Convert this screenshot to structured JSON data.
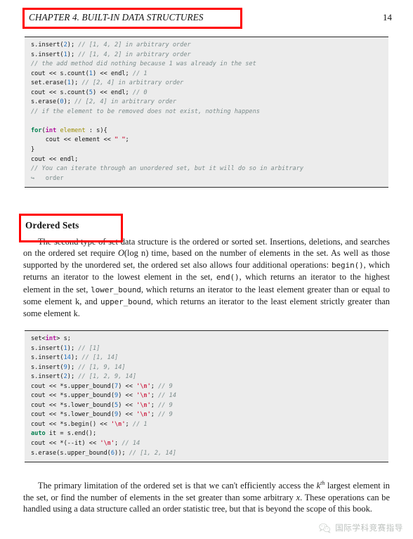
{
  "header": {
    "title": "CHAPTER 4.   BUILT-IN DATA STRUCTURES",
    "page_number": "14"
  },
  "annotations": {
    "accent_color": "#ff0000",
    "boxes": [
      {
        "name": "header-highlight",
        "target": "CHAPTER 4.   BUILT-IN DATA STRUCTURES"
      },
      {
        "name": "heading-highlight",
        "target": "Ordered Sets"
      }
    ]
  },
  "code_block_1": {
    "background": "#ececec",
    "lines": [
      [
        {
          "t": "s.insert(",
          "c": "pln"
        },
        {
          "t": "2",
          "c": "num"
        },
        {
          "t": "); ",
          "c": "pln"
        },
        {
          "t": "// [1, 4, 2] in arbitrary order",
          "c": "cmt"
        }
      ],
      [
        {
          "t": "s.insert(",
          "c": "pln"
        },
        {
          "t": "1",
          "c": "num"
        },
        {
          "t": "); ",
          "c": "pln"
        },
        {
          "t": "// [1, 4, 2] in arbitrary order",
          "c": "cmt"
        }
      ],
      [
        {
          "t": "// the add method did nothing because 1 was already in the set",
          "c": "cmt"
        }
      ],
      [
        {
          "t": "cout << s.count(",
          "c": "pln"
        },
        {
          "t": "1",
          "c": "num"
        },
        {
          "t": ") << endl; ",
          "c": "pln"
        },
        {
          "t": "// 1",
          "c": "cmt"
        }
      ],
      [
        {
          "t": "set.erase(",
          "c": "pln"
        },
        {
          "t": "1",
          "c": "num"
        },
        {
          "t": "); ",
          "c": "pln"
        },
        {
          "t": "// [2, 4] in arbitrary order",
          "c": "cmt"
        }
      ],
      [
        {
          "t": "cout << s.count(",
          "c": "pln"
        },
        {
          "t": "5",
          "c": "num"
        },
        {
          "t": ") << endl; ",
          "c": "pln"
        },
        {
          "t": "// 0",
          "c": "cmt"
        }
      ],
      [
        {
          "t": "s.erase(",
          "c": "pln"
        },
        {
          "t": "0",
          "c": "num"
        },
        {
          "t": "); ",
          "c": "pln"
        },
        {
          "t": "// [2, 4] in arbitrary order",
          "c": "cmt"
        }
      ],
      [
        {
          "t": "// if the element to be removed does not exist, nothing happens",
          "c": "cmt"
        }
      ],
      [
        {
          "t": "",
          "c": "pln"
        }
      ],
      [
        {
          "t": "for",
          "c": "kw"
        },
        {
          "t": "(",
          "c": "pln"
        },
        {
          "t": "int",
          "c": "type"
        },
        {
          "t": " ",
          "c": "pln"
        },
        {
          "t": "element",
          "c": "var"
        },
        {
          "t": " : s){",
          "c": "pln"
        }
      ],
      [
        {
          "t": "    cout << element << ",
          "c": "pln"
        },
        {
          "t": "\" \"",
          "c": "str"
        },
        {
          "t": ";",
          "c": "pln"
        }
      ],
      [
        {
          "t": "}",
          "c": "pln"
        }
      ],
      [
        {
          "t": "cout << endl;",
          "c": "pln"
        }
      ],
      [
        {
          "t": "// You can iterate through an unordered set, but it will do so in arbitrary",
          "c": "cmt"
        }
      ],
      [
        {
          "t": "↪   order",
          "c": "cont"
        }
      ]
    ]
  },
  "heading": {
    "ordered_sets": "Ordered Sets"
  },
  "paragraphs": {
    "ordered_sets": {
      "part1": "The second type of set data structure is the ordered or sorted set. Insertions, deletions, and searches on the ordered set require ",
      "math_O": "O",
      "math_logn": "(log n)",
      "part2": " time, based on the number of elements in the set. As well as those supported by the unordered set, the ordered set also allows four additional operations: ",
      "code_begin": "begin()",
      "part3": ", which returns an iterator to the lowest element in the set, ",
      "code_end": "end()",
      "part4": ", which returns an iterator to the highest element in the set, ",
      "code_lower": "lower_bound",
      "part5": ", which returns an iterator to the least element greater than or equal to some element k, and ",
      "code_upper": "upper_bound",
      "part6": ", which returns an iterator to the least element strictly greater than some element k."
    },
    "limitation": {
      "part1": "The primary limitation of the ordered set is that we can't efficiently access the ",
      "math_k": "k",
      "math_th": "th",
      "part2": " largest element in the set, or find the number of elements in the set greater than some arbitrary ",
      "math_x": "x",
      "part3": ". These operations can be handled using a data structure called an order statistic tree, but that is beyond the scope of this book."
    }
  },
  "code_block_2": {
    "background": "#ececec",
    "lines": [
      [
        {
          "t": "set<",
          "c": "pln"
        },
        {
          "t": "int",
          "c": "type"
        },
        {
          "t": "> s;",
          "c": "pln"
        }
      ],
      [
        {
          "t": "s.insert(",
          "c": "pln"
        },
        {
          "t": "1",
          "c": "num"
        },
        {
          "t": "); ",
          "c": "pln"
        },
        {
          "t": "// [1]",
          "c": "cmt"
        }
      ],
      [
        {
          "t": "s.insert(",
          "c": "pln"
        },
        {
          "t": "14",
          "c": "num"
        },
        {
          "t": "); ",
          "c": "pln"
        },
        {
          "t": "// [1, 14]",
          "c": "cmt"
        }
      ],
      [
        {
          "t": "s.insert(",
          "c": "pln"
        },
        {
          "t": "9",
          "c": "num"
        },
        {
          "t": "); ",
          "c": "pln"
        },
        {
          "t": "// [1, 9, 14]",
          "c": "cmt"
        }
      ],
      [
        {
          "t": "s.insert(",
          "c": "pln"
        },
        {
          "t": "2",
          "c": "num"
        },
        {
          "t": "); ",
          "c": "pln"
        },
        {
          "t": "// [1, 2, 9, 14]",
          "c": "cmt"
        }
      ],
      [
        {
          "t": "cout << *s.upper_bound(",
          "c": "pln"
        },
        {
          "t": "7",
          "c": "num"
        },
        {
          "t": ") << ",
          "c": "pln"
        },
        {
          "t": "'\\n'",
          "c": "str"
        },
        {
          "t": "; ",
          "c": "pln"
        },
        {
          "t": "// 9",
          "c": "cmt"
        }
      ],
      [
        {
          "t": "cout << *s.upper_bound(",
          "c": "pln"
        },
        {
          "t": "9",
          "c": "num"
        },
        {
          "t": ") << ",
          "c": "pln"
        },
        {
          "t": "'\\n'",
          "c": "str"
        },
        {
          "t": "; ",
          "c": "pln"
        },
        {
          "t": "// 14",
          "c": "cmt"
        }
      ],
      [
        {
          "t": "cout << *s.lower_bound(",
          "c": "pln"
        },
        {
          "t": "5",
          "c": "num"
        },
        {
          "t": ") << ",
          "c": "pln"
        },
        {
          "t": "'\\n'",
          "c": "str"
        },
        {
          "t": "; ",
          "c": "pln"
        },
        {
          "t": "// 9",
          "c": "cmt"
        }
      ],
      [
        {
          "t": "cout << *s.lower_bound(",
          "c": "pln"
        },
        {
          "t": "9",
          "c": "num"
        },
        {
          "t": ") << ",
          "c": "pln"
        },
        {
          "t": "'\\n'",
          "c": "str"
        },
        {
          "t": "; ",
          "c": "pln"
        },
        {
          "t": "// 9",
          "c": "cmt"
        }
      ],
      [
        {
          "t": "cout << *s.begin() << ",
          "c": "pln"
        },
        {
          "t": "'\\n'",
          "c": "str"
        },
        {
          "t": "; ",
          "c": "pln"
        },
        {
          "t": "// 1",
          "c": "cmt"
        }
      ],
      [
        {
          "t": "auto",
          "c": "kw"
        },
        {
          "t": " it = s.end();",
          "c": "pln"
        }
      ],
      [
        {
          "t": "cout << *(--it) << ",
          "c": "pln"
        },
        {
          "t": "'\\n'",
          "c": "str"
        },
        {
          "t": "; ",
          "c": "pln"
        },
        {
          "t": "// 14",
          "c": "cmt"
        }
      ],
      [
        {
          "t": "s.erase(s.upper_bound(",
          "c": "pln"
        },
        {
          "t": "6",
          "c": "num"
        },
        {
          "t": ")); ",
          "c": "pln"
        },
        {
          "t": "// [1, 2, 14]",
          "c": "cmt"
        }
      ]
    ]
  },
  "watermark": {
    "text": "国际学科竞赛指导",
    "logo": "wechat-icon",
    "color": "#5f6a62"
  }
}
